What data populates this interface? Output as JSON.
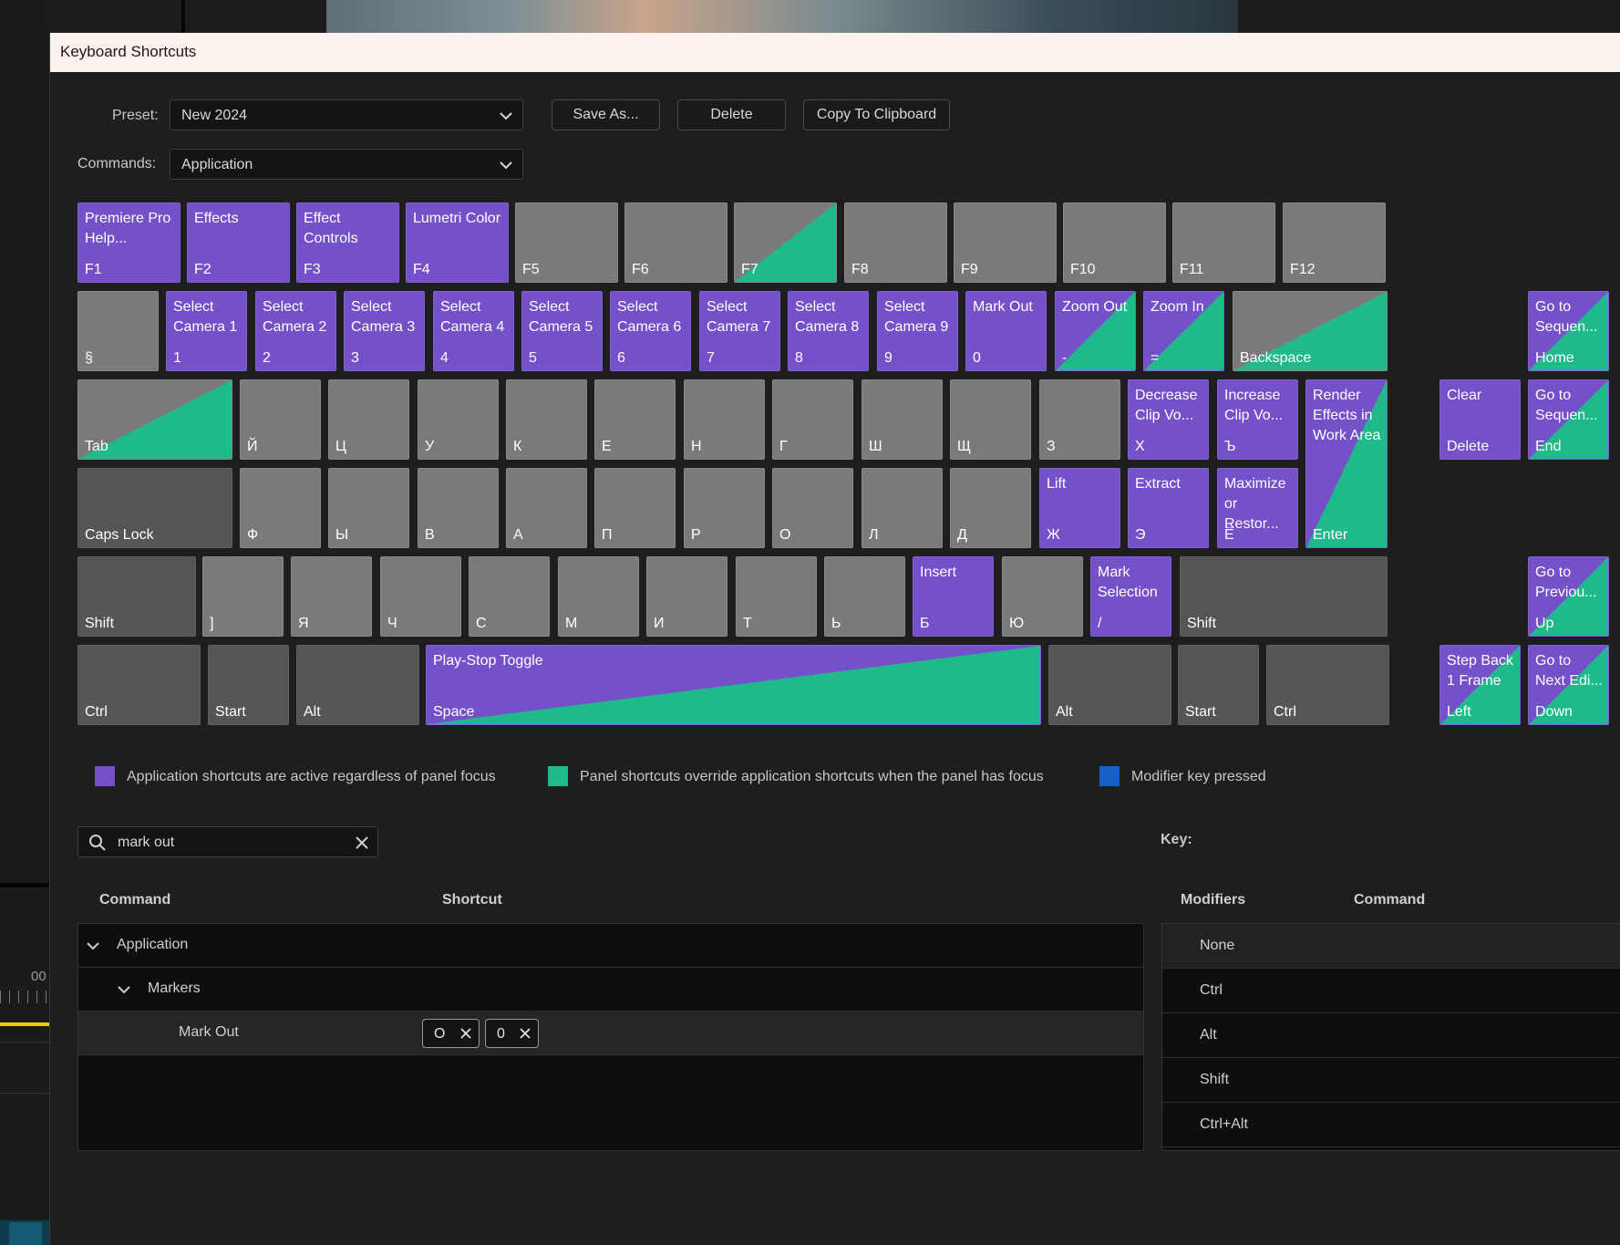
{
  "window_title": "Keyboard Shortcuts",
  "preset": {
    "label": "Preset:",
    "value": "New 2024"
  },
  "commands": {
    "label": "Commands:",
    "value": "Application"
  },
  "buttons": {
    "save_as": "Save As...",
    "delete": "Delete",
    "copy": "Copy To Clipboard"
  },
  "background": {
    "timecode": "00"
  },
  "keys": [
    {
      "id": "f1",
      "cap": "F1",
      "cmd": "Premiere Pro Help...",
      "state": "app"
    },
    {
      "id": "f2",
      "cap": "F2",
      "cmd": "Effects",
      "state": "app"
    },
    {
      "id": "f3",
      "cap": "F3",
      "cmd": "Effect Controls",
      "state": "app"
    },
    {
      "id": "f4",
      "cap": "F4",
      "cmd": "Lumetri Color",
      "state": "app"
    },
    {
      "id": "f5",
      "cap": "F5",
      "cmd": "",
      "state": "none"
    },
    {
      "id": "f6",
      "cap": "F6",
      "cmd": "",
      "state": "none"
    },
    {
      "id": "f7",
      "cap": "F7",
      "cmd": "",
      "state": "gray-panel"
    },
    {
      "id": "f8",
      "cap": "F8",
      "cmd": "",
      "state": "none"
    },
    {
      "id": "f9",
      "cap": "F9",
      "cmd": "",
      "state": "none"
    },
    {
      "id": "f10",
      "cap": "F10",
      "cmd": "",
      "state": "none"
    },
    {
      "id": "f11",
      "cap": "F11",
      "cmd": "",
      "state": "none"
    },
    {
      "id": "f12",
      "cap": "F12",
      "cmd": "",
      "state": "none"
    },
    {
      "id": "section",
      "cap": "§",
      "cmd": "",
      "state": "none"
    },
    {
      "id": "d1",
      "cap": "1",
      "cmd": "Select Camera 1",
      "state": "app"
    },
    {
      "id": "d2",
      "cap": "2",
      "cmd": "Select Camera 2",
      "state": "app"
    },
    {
      "id": "d3",
      "cap": "3",
      "cmd": "Select Camera 3",
      "state": "app"
    },
    {
      "id": "d4",
      "cap": "4",
      "cmd": "Select Camera 4",
      "state": "app"
    },
    {
      "id": "d5",
      "cap": "5",
      "cmd": "Select Camera 5",
      "state": "app"
    },
    {
      "id": "d6",
      "cap": "6",
      "cmd": "Select Camera 6",
      "state": "app"
    },
    {
      "id": "d7",
      "cap": "7",
      "cmd": "Select Camera 7",
      "state": "app"
    },
    {
      "id": "d8",
      "cap": "8",
      "cmd": "Select Camera 8",
      "state": "app"
    },
    {
      "id": "d9",
      "cap": "9",
      "cmd": "Select Camera 9",
      "state": "app"
    },
    {
      "id": "d0",
      "cap": "0",
      "cmd": "Mark Out",
      "state": "app"
    },
    {
      "id": "minus",
      "cap": "-",
      "cmd": "Zoom Out",
      "state": "app-panel"
    },
    {
      "id": "equal",
      "cap": "=",
      "cmd": "Zoom In",
      "state": "app-panel"
    },
    {
      "id": "backspace",
      "cap": "Backspace",
      "cmd": "",
      "state": "gray-panel"
    },
    {
      "id": "tab",
      "cap": "Tab",
      "cmd": "",
      "state": "gray-panel"
    },
    {
      "id": "k-y",
      "cap": "Й",
      "cmd": "",
      "state": "none"
    },
    {
      "id": "k-ts",
      "cap": "Ц",
      "cmd": "",
      "state": "none"
    },
    {
      "id": "k-u",
      "cap": "У",
      "cmd": "",
      "state": "none"
    },
    {
      "id": "k-k",
      "cap": "К",
      "cmd": "",
      "state": "none"
    },
    {
      "id": "k-e",
      "cap": "Е",
      "cmd": "",
      "state": "none"
    },
    {
      "id": "k-n",
      "cap": "Н",
      "cmd": "",
      "state": "none"
    },
    {
      "id": "k-g",
      "cap": "Г",
      "cmd": "",
      "state": "none"
    },
    {
      "id": "k-sh",
      "cap": "Ш",
      "cmd": "",
      "state": "none"
    },
    {
      "id": "k-shch",
      "cap": "Щ",
      "cmd": "",
      "state": "none"
    },
    {
      "id": "k-z",
      "cap": "З",
      "cmd": "",
      "state": "none"
    },
    {
      "id": "k-kh",
      "cap": "Х",
      "cmd": "Decrease Clip Vo...",
      "state": "app"
    },
    {
      "id": "k-hard",
      "cap": "Ъ",
      "cmd": "Increase Clip Vo...",
      "state": "app"
    },
    {
      "id": "enter",
      "cap": "Enter",
      "cmd": "Render Effects in Work Area",
      "state": "app-panel"
    },
    {
      "id": "capslock",
      "cap": "Caps Lock",
      "cmd": "",
      "state": "dark"
    },
    {
      "id": "k-f",
      "cap": "Ф",
      "cmd": "",
      "state": "none"
    },
    {
      "id": "k-yy",
      "cap": "Ы",
      "cmd": "",
      "state": "none"
    },
    {
      "id": "k-v",
      "cap": "В",
      "cmd": "",
      "state": "none"
    },
    {
      "id": "k-a",
      "cap": "А",
      "cmd": "",
      "state": "none"
    },
    {
      "id": "k-p",
      "cap": "П",
      "cmd": "",
      "state": "none"
    },
    {
      "id": "k-r",
      "cap": "Р",
      "cmd": "",
      "state": "none"
    },
    {
      "id": "k-o",
      "cap": "О",
      "cmd": "",
      "state": "none"
    },
    {
      "id": "k-l",
      "cap": "Л",
      "cmd": "",
      "state": "none"
    },
    {
      "id": "k-d",
      "cap": "Д",
      "cmd": "",
      "state": "none"
    },
    {
      "id": "k-zh",
      "cap": "Ж",
      "cmd": "Lift",
      "state": "app"
    },
    {
      "id": "k-ee",
      "cap": "Э",
      "cmd": "Extract",
      "state": "app"
    },
    {
      "id": "k-yo",
      "cap": "Ё",
      "cmd": "Maximize or Restor...",
      "state": "app"
    },
    {
      "id": "lshift",
      "cap": "Shift",
      "cmd": "",
      "state": "dark"
    },
    {
      "id": "bracket",
      "cap": "]",
      "cmd": "",
      "state": "none"
    },
    {
      "id": "k-ya",
      "cap": "Я",
      "cmd": "",
      "state": "none"
    },
    {
      "id": "k-ch",
      "cap": "Ч",
      "cmd": "",
      "state": "none"
    },
    {
      "id": "k-s",
      "cap": "С",
      "cmd": "",
      "state": "none"
    },
    {
      "id": "k-m",
      "cap": "М",
      "cmd": "",
      "state": "none"
    },
    {
      "id": "k-i",
      "cap": "И",
      "cmd": "",
      "state": "none"
    },
    {
      "id": "k-t",
      "cap": "Т",
      "cmd": "",
      "state": "none"
    },
    {
      "id": "k-soft",
      "cap": "Ь",
      "cmd": "",
      "state": "none"
    },
    {
      "id": "k-b",
      "cap": "Б",
      "cmd": "Insert",
      "state": "app"
    },
    {
      "id": "k-yu",
      "cap": "Ю",
      "cmd": "",
      "state": "none"
    },
    {
      "id": "slash",
      "cap": "/",
      "cmd": "Mark Selection",
      "state": "app"
    },
    {
      "id": "rshift",
      "cap": "Shift",
      "cmd": "",
      "state": "dark"
    },
    {
      "id": "lctrl",
      "cap": "Ctrl",
      "cmd": "",
      "state": "dark"
    },
    {
      "id": "lstart",
      "cap": "Start",
      "cmd": "",
      "state": "dark"
    },
    {
      "id": "lalt",
      "cap": "Alt",
      "cmd": "",
      "state": "dark"
    },
    {
      "id": "space",
      "cap": "Space",
      "cmd": "Play-Stop Toggle",
      "state": "app-panel"
    },
    {
      "id": "ralt",
      "cap": "Alt",
      "cmd": "",
      "state": "dark"
    },
    {
      "id": "rstart",
      "cap": "Start",
      "cmd": "",
      "state": "dark"
    },
    {
      "id": "rctrl",
      "cap": "Ctrl",
      "cmd": "",
      "state": "dark"
    },
    {
      "id": "clear",
      "cap": "Delete",
      "cmd": "Clear",
      "state": "app"
    },
    {
      "id": "home",
      "cap": "Home",
      "cmd": "Go to Sequen...",
      "state": "app-panel"
    },
    {
      "id": "end",
      "cap": "End",
      "cmd": "Go to Sequen...",
      "state": "app-panel"
    },
    {
      "id": "up",
      "cap": "Up",
      "cmd": "Go to Previou...",
      "state": "app-panel"
    },
    {
      "id": "left",
      "cap": "Left",
      "cmd": "Step Back 1 Frame",
      "state": "app-panel"
    },
    {
      "id": "down",
      "cap": "Down",
      "cmd": "Go to Next Edi...",
      "state": "app-panel"
    }
  ],
  "legend": {
    "app": "Application shortcuts are active regardless of panel focus",
    "panel": "Panel shortcuts override application shortcuts when the panel has focus",
    "modifier": "Modifier key pressed",
    "colors": {
      "app": "#7451c9",
      "panel": "#1fb98b",
      "modifier": "#1560c4"
    }
  },
  "search": {
    "value": "mark out"
  },
  "table": {
    "headers": {
      "command": "Command",
      "shortcut": "Shortcut"
    },
    "rows": [
      {
        "label": "Application",
        "level": 0,
        "expanded": true
      },
      {
        "label": "Markers",
        "level": 1,
        "expanded": true
      },
      {
        "label": "Mark Out",
        "level": 2,
        "shortcuts": [
          "O",
          "0"
        ]
      }
    ]
  },
  "key_panel": {
    "label": "Key:",
    "headers": {
      "modifiers": "Modifiers",
      "command": "Command"
    },
    "modifiers": [
      "None",
      "Ctrl",
      "Alt",
      "Shift",
      "Ctrl+Alt"
    ]
  }
}
